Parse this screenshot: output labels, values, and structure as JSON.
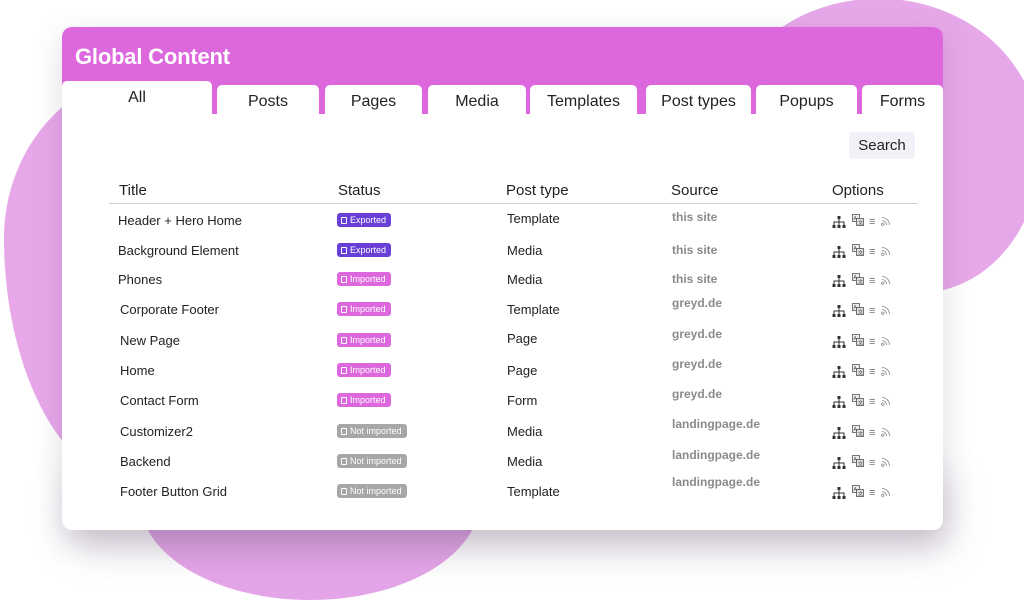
{
  "app": {
    "title": "Global Content"
  },
  "tabs": [
    {
      "label": "All",
      "active": true
    },
    {
      "label": "Posts",
      "active": false
    },
    {
      "label": "Pages",
      "active": false
    },
    {
      "label": "Media",
      "active": false
    },
    {
      "label": "Templates",
      "active": false
    },
    {
      "label": "Post types",
      "active": false
    },
    {
      "label": "Popups",
      "active": false
    },
    {
      "label": "Forms",
      "active": false
    }
  ],
  "search": {
    "label": "Search"
  },
  "table": {
    "columns": [
      "Title",
      "Status",
      "Post type",
      "Source",
      "Options"
    ],
    "rows": [
      {
        "title": "Header + Hero Home",
        "status": "Exported",
        "status_kind": "exported",
        "post_type": "Template",
        "source": "this site"
      },
      {
        "title": "Background Element",
        "status": "Exported",
        "status_kind": "exported",
        "post_type": "Media",
        "source": "this site"
      },
      {
        "title": "Phones",
        "status": "Imported",
        "status_kind": "imported",
        "post_type": "Media",
        "source": "this site"
      },
      {
        "title": "Corporate Footer",
        "status": "Imported",
        "status_kind": "imported",
        "post_type": "Template",
        "source": "greyd.de"
      },
      {
        "title": "New Page",
        "status": "Imported",
        "status_kind": "imported",
        "post_type": "Page",
        "source": "greyd.de"
      },
      {
        "title": "Home",
        "status": "Imported",
        "status_kind": "imported",
        "post_type": "Page",
        "source": "greyd.de"
      },
      {
        "title": "Contact Form",
        "status": "Imported",
        "status_kind": "imported",
        "post_type": "Form",
        "source": "greyd.de"
      },
      {
        "title": "Customizer2",
        "status": "Not imported",
        "status_kind": "not",
        "post_type": "Media",
        "source": "landingpage.de"
      },
      {
        "title": "Backend",
        "status": "Not imported",
        "status_kind": "not",
        "post_type": "Media",
        "source": "landingpage.de"
      },
      {
        "title": "Footer Button Grid",
        "status": "Not imported",
        "status_kind": "not",
        "post_type": "Template",
        "source": "landingpage.de"
      }
    ],
    "option_icons": [
      "sitemap-icon",
      "translate-icon",
      "list-icon",
      "rss-icon"
    ],
    "option_list_glyph": "≡"
  },
  "colors": {
    "header": "#dd68de",
    "exported": "#6a3fd6",
    "imported": "#dd68de",
    "not_imported": "#a7a7a7",
    "blob": "#e7a8ea"
  }
}
